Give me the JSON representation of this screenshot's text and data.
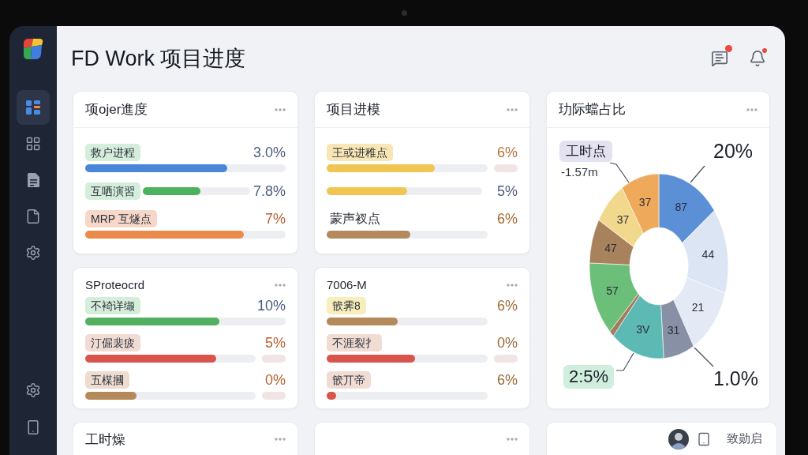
{
  "sidebar": {
    "items": [
      {
        "selected": true
      },
      {
        "selected": false
      },
      {
        "selected": false
      },
      {
        "selected": false
      },
      {
        "selected": false
      }
    ]
  },
  "header": {
    "title": "FD Work 项目进度",
    "messages_badge": true,
    "alerts_badge": true
  },
  "cards": [
    {
      "title": "项ojer進度",
      "divider": true,
      "rows": [
        {
          "kind": "stacked",
          "label": {
            "text": "救户进程",
            "color": "#d5eedb"
          },
          "value": {
            "text": "3.0%",
            "color": "#4b5b7c"
          },
          "color": "#4a86d8",
          "level": 0.71
        },
        {
          "kind": "inline",
          "label": {
            "text": "互哂演習",
            "color": "#d5eedb"
          },
          "value": {
            "text": "7.8%",
            "color": "#4b5b7c"
          },
          "color": "#4cb25e",
          "level": 0.54
        },
        {
          "kind": "stacked",
          "label": {
            "text": "MRP 互燧点",
            "color": "#f7d8c8"
          },
          "value": {
            "text": "7%",
            "color": "#b5602c"
          },
          "color": "#ec8a4c",
          "level": 0.79
        }
      ]
    },
    {
      "title": "项目进模",
      "divider": true,
      "rows": [
        {
          "kind": "split",
          "label": {
            "text": "王或进稚点",
            "color": "#f8e6b4"
          },
          "value": {
            "text": "6%",
            "color": "#b5713a"
          },
          "color": "#f0c552",
          "level": 0.67,
          "stub": true
        },
        {
          "kind": "inline",
          "value": {
            "text": "5%",
            "color": "#4b5b7c"
          },
          "color": "#f0c552",
          "level": 0.52
        },
        {
          "kind": "split",
          "label": {
            "text": "蒙声衩点"
          },
          "value": {
            "text": "6%",
            "color": "#a8652e"
          },
          "color": "#b48a5c",
          "level": 0.52
        }
      ]
    },
    {
      "title": "SProteocrd",
      "divider": false,
      "rows": [
        {
          "kind": "stacked",
          "label": {
            "text": "不裿详缬",
            "color": "#d5eedb"
          },
          "value": {
            "text": "10%",
            "color": "#4b5b7c"
          },
          "color": "#52b060",
          "level": 0.67
        },
        {
          "kind": "split",
          "label": {
            "text": "汀倔裴疲",
            "color": "#f1dcd3"
          },
          "value": {
            "text": "5%",
            "color": "#b5602c"
          },
          "color": "#d9544b",
          "level": 0.77,
          "stub": true
        },
        {
          "kind": "split",
          "label": {
            "text": "五楳摑",
            "color": "#eedcd0"
          },
          "value": {
            "text": "0%",
            "color": "#b5602c"
          },
          "color": "#b58a5a",
          "level": 0.3,
          "stub": true
        }
      ]
    },
    {
      "title": "7006-M",
      "divider": false,
      "rows": [
        {
          "kind": "split",
          "label": {
            "text": "篏霁8",
            "color": "#f7eebc"
          },
          "value": {
            "text": "6%",
            "color": "#9c6a35"
          },
          "color": "#b58a5a",
          "level": 0.44
        },
        {
          "kind": "split",
          "label": {
            "text": "不涯裂扌",
            "color": "#f1dcd3"
          },
          "value": {
            "text": "0%",
            "color": "#9c6a35"
          },
          "color": "#d9544b",
          "level": 0.55,
          "stub": true
        },
        {
          "kind": "split",
          "label": {
            "text": "篏丌帝",
            "color": "#f1dcd3"
          },
          "value": {
            "text": "6%",
            "color": "#9c6a35"
          },
          "color": "#d9544b",
          "level": 0.06
        }
      ]
    }
  ],
  "donut_card": {
    "title": "玏际蟷占比",
    "divider": true,
    "slices": [
      {
        "label": "87",
        "color": "#5b8fd6"
      },
      {
        "label": "44",
        "color": "#dbe5f3"
      },
      {
        "label": "21",
        "color": "#e4eaf5"
      },
      {
        "label": "31",
        "color": "#8890a6"
      },
      {
        "label": "3V",
        "color": "#5db9b4"
      },
      {
        "color": "#a27c5e"
      },
      {
        "label": "57",
        "color": "#6bbf79"
      },
      {
        "label": "47",
        "color": "#a8825c"
      },
      {
        "label": "37",
        "color": "#f2d88c"
      },
      {
        "label": "37",
        "color": "#eea95b"
      }
    ],
    "callouts": [
      {
        "kind": "tag",
        "text": "工时点",
        "color": "#e4e1f1"
      },
      {
        "kind": "figure",
        "text": "20%"
      },
      {
        "kind": "note",
        "text": "-1.57m"
      },
      {
        "kind": "tag",
        "text": "2:5%",
        "color": "#cfeedd"
      },
      {
        "kind": "figure",
        "text": "1.0%"
      }
    ]
  },
  "bottom": {
    "left_card": {
      "title": "工时燥"
    },
    "user_bar": {
      "text": "致勋启"
    }
  }
}
